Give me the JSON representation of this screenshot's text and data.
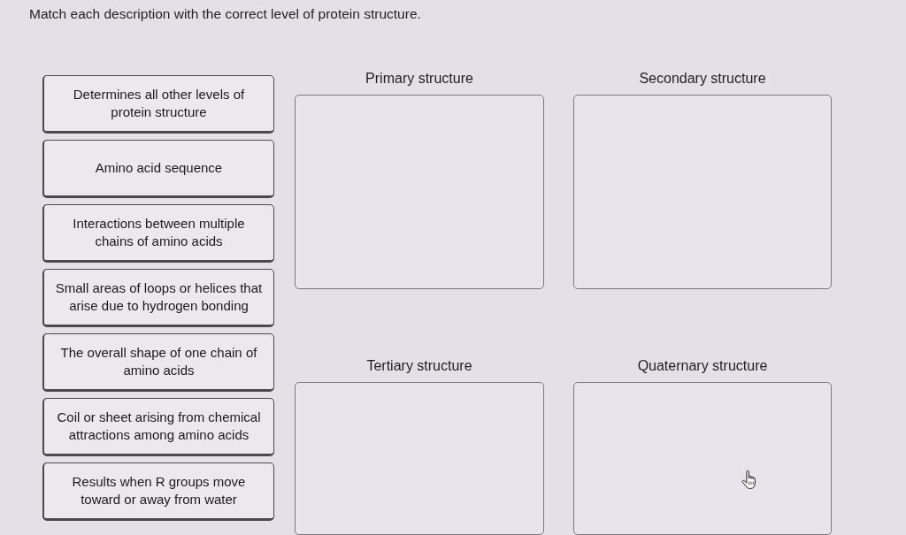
{
  "instruction": "Match each description with the correct level of protein structure.",
  "cards": [
    "Determines all other levels of protein structure",
    "Amino acid sequence",
    "Interactions between multiple chains of amino acids",
    "Small areas of loops or helices that arise due to hydrogen bonding",
    "The overall shape of one chain of amino acids",
    "Coil or sheet arising from chemical attractions among amino acids",
    "Results when R groups move toward or away from water"
  ],
  "targets": [
    {
      "label": "Primary structure"
    },
    {
      "label": "Secondary structure"
    },
    {
      "label": "Tertiary structure"
    },
    {
      "label": "Quaternary structure"
    }
  ]
}
